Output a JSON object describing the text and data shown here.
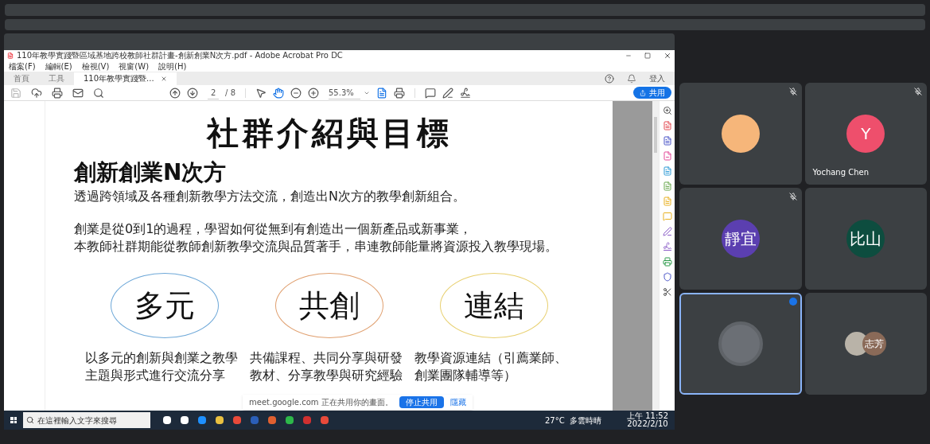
{
  "acrobat": {
    "title": "110年教學實踐暨區域基地跨校教師社群計畫-創新創業N次方.pdf - Adobe Acrobat Pro DC",
    "menu": [
      "檔案(F)",
      "編輯(E)",
      "檢視(V)",
      "視窗(W)",
      "說明(H)"
    ],
    "tabs": [
      {
        "label": "首頁",
        "selected": false
      },
      {
        "label": "工具",
        "selected": false
      },
      {
        "label": "110年教學實踐暨...",
        "selected": true
      }
    ],
    "sign_in": "登入",
    "share": "共用",
    "page": "2",
    "page_total": "/ 8",
    "zoom": "55.3%"
  },
  "slide": {
    "title": "社群介紹與目標",
    "heading": "創新創業N次方",
    "intro": "透過跨領域及各種創新教學方法交流，創造出N次方的教學創新組合。",
    "paragraph": [
      "創業是從0到1的過程，學習如何從無到有創造出一個新產品或新事業，",
      "本教師社群期能從教師創新教學交流與品質著手，串連教師能量將資源投入教學現場。"
    ],
    "pillars": [
      {
        "label": "多元",
        "color": "#6ea8d8",
        "caption": "以多元的創新與創業之教學主題與形式進行交流分享"
      },
      {
        "label": "共創",
        "color": "#e0a070",
        "caption": "共備課程、共同分享與研發教材、分享教學與研究經驗"
      },
      {
        "label": "連結",
        "color": "#e8d070",
        "caption": "教學資源連結（引薦業師、創業團隊輔導等）"
      }
    ]
  },
  "share_notice": {
    "text": "meet.google.com 正在共用你的畫面。",
    "stop": "停止共用",
    "hide": "隱藏"
  },
  "taskbar": {
    "search": "在這裡輸入文字來搜尋",
    "weather": "27°C  多雲時晴",
    "time": "上午 11:52",
    "date": "2022/2/10"
  },
  "participants": [
    {
      "kind": "avatar",
      "color": "#f6b67a",
      "muted": true,
      "speaking": false
    },
    {
      "kind": "avatar",
      "initials": "Y",
      "color": "#ee4f6c",
      "name": "Yochang Chen",
      "muted": true,
      "speaking": false
    },
    {
      "kind": "avatar",
      "initials": "靜宜",
      "color": "#5b3fb0",
      "muted": true,
      "speaking": false
    },
    {
      "kind": "avatar",
      "initials": "比山",
      "color": "#0d4d3f",
      "muted": false,
      "speaking": false
    },
    {
      "kind": "photo",
      "muted": false,
      "speaking": true
    },
    {
      "kind": "group",
      "initials": "志芳",
      "color": "#8a6a58",
      "muted": false,
      "speaking": false
    }
  ]
}
